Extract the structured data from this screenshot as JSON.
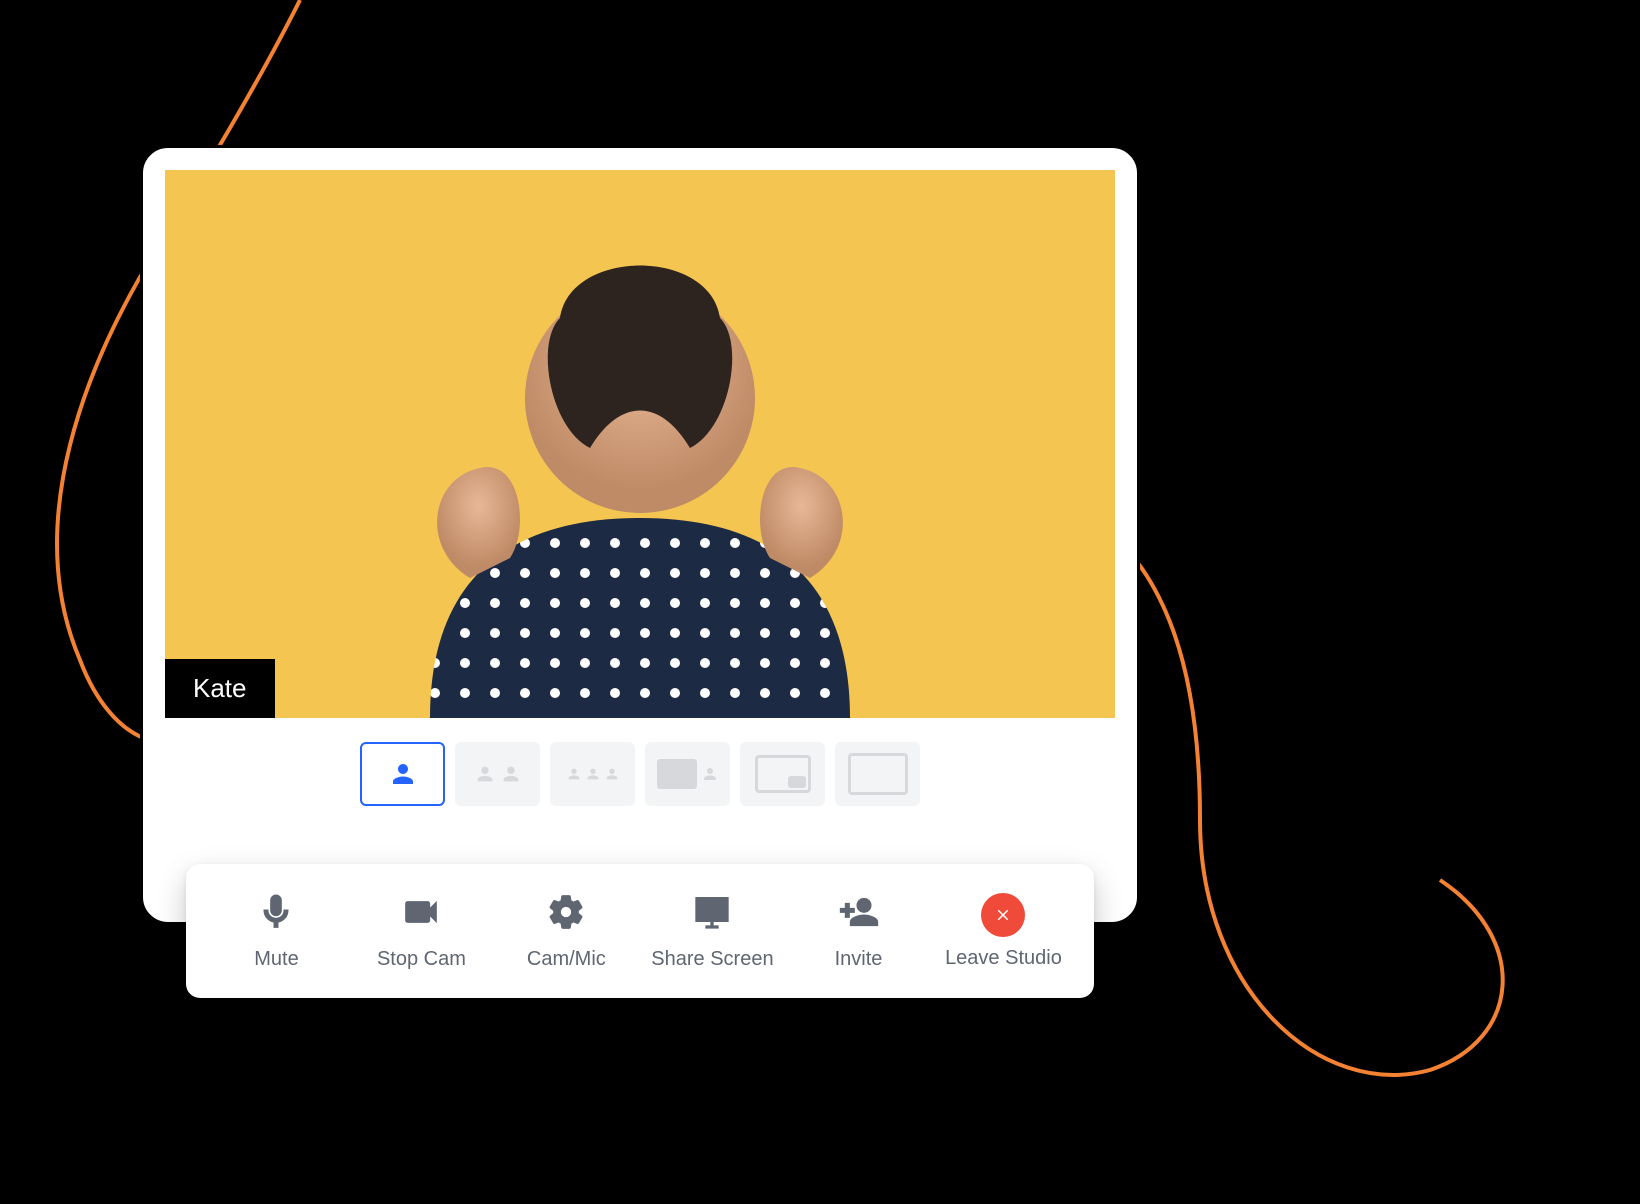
{
  "participant": {
    "name": "Kate"
  },
  "colors": {
    "video_bg": "#f5c551",
    "accent": "#2463ff",
    "leave": "#ef4a3a",
    "scribble": "#f58233"
  },
  "layouts": [
    {
      "id": "solo",
      "active": true
    },
    {
      "id": "two-up",
      "active": false
    },
    {
      "id": "grid-3",
      "active": false
    },
    {
      "id": "pip",
      "active": false
    },
    {
      "id": "spotlight",
      "active": false
    },
    {
      "id": "full",
      "active": false
    }
  ],
  "toolbar": {
    "mute": "Mute",
    "stop": "Stop Cam",
    "device": "Cam/Mic",
    "share": "Share Screen",
    "invite": "Invite",
    "leave": "Leave Studio"
  }
}
